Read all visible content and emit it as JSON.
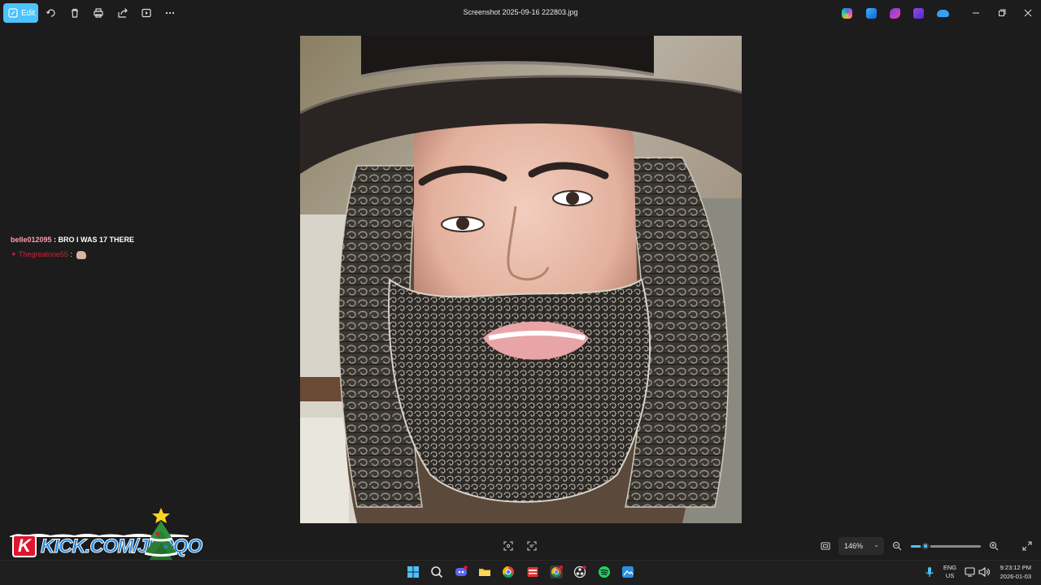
{
  "toolbar": {
    "edit_label": "Edit",
    "title": "Screenshot 2025-09-16 222803.jpg",
    "icons": [
      "rotate-icon",
      "delete-icon",
      "print-icon",
      "share-icon",
      "slideshow-icon",
      "more-icon"
    ],
    "app_icons": [
      "copilot-icon",
      "photos-editor-icon",
      "clipchamp-icon",
      "designer-icon",
      "onedrive-icon"
    ]
  },
  "chat": {
    "line1_user": "belle012095",
    "line1_sep": " : ",
    "line1_msg": "BRO I WAS 17 THERE",
    "line2_user": "Thegreatone55",
    "line2_sep": " : "
  },
  "overlay": {
    "kick_url": "KICK.COM/JERQO"
  },
  "viewer": {
    "zoom": "146%",
    "zoom_level_percent": 146
  },
  "tray": {
    "lang_top": "ENG",
    "lang_bottom": "US",
    "time": "9:23:12 PM",
    "date": "2026-01-03"
  },
  "colors": {
    "accent": "#4cc2ff",
    "background": "#1c1c1c",
    "chat_user": "#ff9cae",
    "chat_user2": "#d01f3c",
    "kick_red": "#e0142d",
    "kick_blue": "#1b88e6"
  }
}
